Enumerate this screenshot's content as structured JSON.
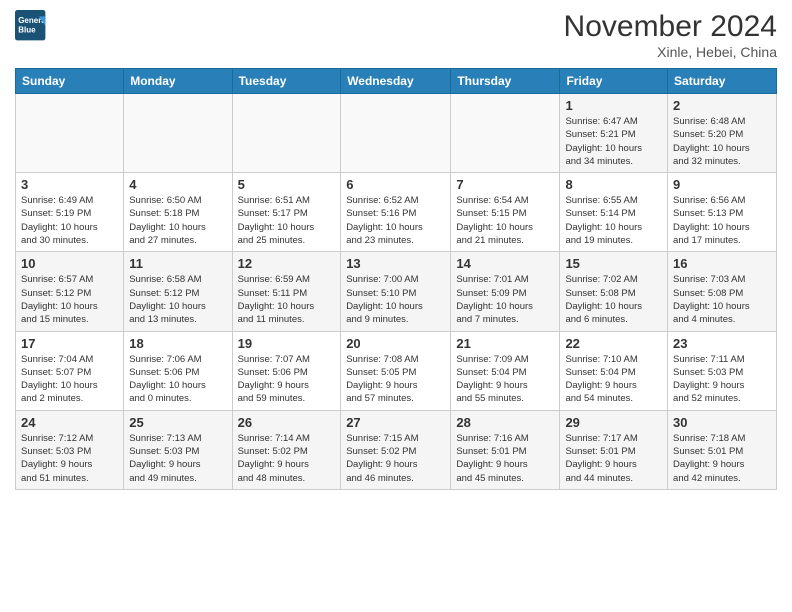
{
  "header": {
    "logo_line1": "General",
    "logo_line2": "Blue",
    "month": "November 2024",
    "location": "Xinle, Hebei, China"
  },
  "days_of_week": [
    "Sunday",
    "Monday",
    "Tuesday",
    "Wednesday",
    "Thursday",
    "Friday",
    "Saturday"
  ],
  "weeks": [
    [
      {
        "day": "",
        "info": ""
      },
      {
        "day": "",
        "info": ""
      },
      {
        "day": "",
        "info": ""
      },
      {
        "day": "",
        "info": ""
      },
      {
        "day": "",
        "info": ""
      },
      {
        "day": "1",
        "info": "Sunrise: 6:47 AM\nSunset: 5:21 PM\nDaylight: 10 hours\nand 34 minutes."
      },
      {
        "day": "2",
        "info": "Sunrise: 6:48 AM\nSunset: 5:20 PM\nDaylight: 10 hours\nand 32 minutes."
      }
    ],
    [
      {
        "day": "3",
        "info": "Sunrise: 6:49 AM\nSunset: 5:19 PM\nDaylight: 10 hours\nand 30 minutes."
      },
      {
        "day": "4",
        "info": "Sunrise: 6:50 AM\nSunset: 5:18 PM\nDaylight: 10 hours\nand 27 minutes."
      },
      {
        "day": "5",
        "info": "Sunrise: 6:51 AM\nSunset: 5:17 PM\nDaylight: 10 hours\nand 25 minutes."
      },
      {
        "day": "6",
        "info": "Sunrise: 6:52 AM\nSunset: 5:16 PM\nDaylight: 10 hours\nand 23 minutes."
      },
      {
        "day": "7",
        "info": "Sunrise: 6:54 AM\nSunset: 5:15 PM\nDaylight: 10 hours\nand 21 minutes."
      },
      {
        "day": "8",
        "info": "Sunrise: 6:55 AM\nSunset: 5:14 PM\nDaylight: 10 hours\nand 19 minutes."
      },
      {
        "day": "9",
        "info": "Sunrise: 6:56 AM\nSunset: 5:13 PM\nDaylight: 10 hours\nand 17 minutes."
      }
    ],
    [
      {
        "day": "10",
        "info": "Sunrise: 6:57 AM\nSunset: 5:12 PM\nDaylight: 10 hours\nand 15 minutes."
      },
      {
        "day": "11",
        "info": "Sunrise: 6:58 AM\nSunset: 5:12 PM\nDaylight: 10 hours\nand 13 minutes."
      },
      {
        "day": "12",
        "info": "Sunrise: 6:59 AM\nSunset: 5:11 PM\nDaylight: 10 hours\nand 11 minutes."
      },
      {
        "day": "13",
        "info": "Sunrise: 7:00 AM\nSunset: 5:10 PM\nDaylight: 10 hours\nand 9 minutes."
      },
      {
        "day": "14",
        "info": "Sunrise: 7:01 AM\nSunset: 5:09 PM\nDaylight: 10 hours\nand 7 minutes."
      },
      {
        "day": "15",
        "info": "Sunrise: 7:02 AM\nSunset: 5:08 PM\nDaylight: 10 hours\nand 6 minutes."
      },
      {
        "day": "16",
        "info": "Sunrise: 7:03 AM\nSunset: 5:08 PM\nDaylight: 10 hours\nand 4 minutes."
      }
    ],
    [
      {
        "day": "17",
        "info": "Sunrise: 7:04 AM\nSunset: 5:07 PM\nDaylight: 10 hours\nand 2 minutes."
      },
      {
        "day": "18",
        "info": "Sunrise: 7:06 AM\nSunset: 5:06 PM\nDaylight: 10 hours\nand 0 minutes."
      },
      {
        "day": "19",
        "info": "Sunrise: 7:07 AM\nSunset: 5:06 PM\nDaylight: 9 hours\nand 59 minutes."
      },
      {
        "day": "20",
        "info": "Sunrise: 7:08 AM\nSunset: 5:05 PM\nDaylight: 9 hours\nand 57 minutes."
      },
      {
        "day": "21",
        "info": "Sunrise: 7:09 AM\nSunset: 5:04 PM\nDaylight: 9 hours\nand 55 minutes."
      },
      {
        "day": "22",
        "info": "Sunrise: 7:10 AM\nSunset: 5:04 PM\nDaylight: 9 hours\nand 54 minutes."
      },
      {
        "day": "23",
        "info": "Sunrise: 7:11 AM\nSunset: 5:03 PM\nDaylight: 9 hours\nand 52 minutes."
      }
    ],
    [
      {
        "day": "24",
        "info": "Sunrise: 7:12 AM\nSunset: 5:03 PM\nDaylight: 9 hours\nand 51 minutes."
      },
      {
        "day": "25",
        "info": "Sunrise: 7:13 AM\nSunset: 5:03 PM\nDaylight: 9 hours\nand 49 minutes."
      },
      {
        "day": "26",
        "info": "Sunrise: 7:14 AM\nSunset: 5:02 PM\nDaylight: 9 hours\nand 48 minutes."
      },
      {
        "day": "27",
        "info": "Sunrise: 7:15 AM\nSunset: 5:02 PM\nDaylight: 9 hours\nand 46 minutes."
      },
      {
        "day": "28",
        "info": "Sunrise: 7:16 AM\nSunset: 5:01 PM\nDaylight: 9 hours\nand 45 minutes."
      },
      {
        "day": "29",
        "info": "Sunrise: 7:17 AM\nSunset: 5:01 PM\nDaylight: 9 hours\nand 44 minutes."
      },
      {
        "day": "30",
        "info": "Sunrise: 7:18 AM\nSunset: 5:01 PM\nDaylight: 9 hours\nand 42 minutes."
      }
    ]
  ]
}
